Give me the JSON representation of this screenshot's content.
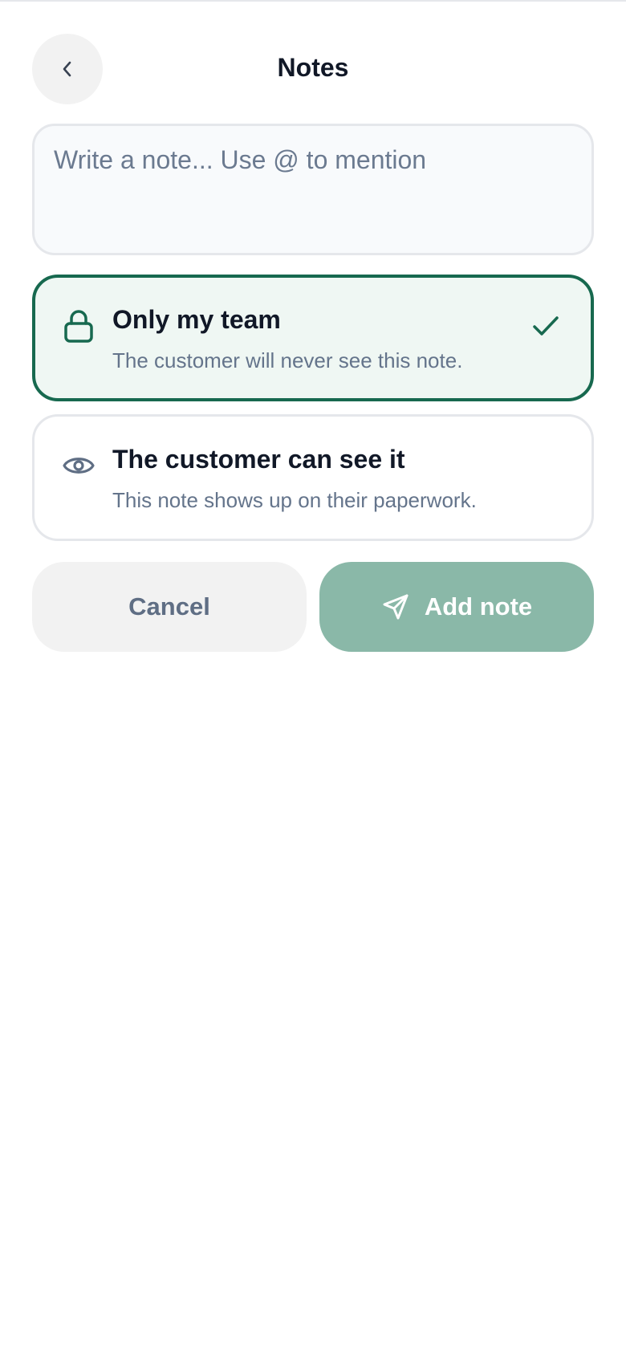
{
  "header": {
    "title": "Notes",
    "back_icon": "chevron-left-icon"
  },
  "note_input": {
    "value": "",
    "placeholder": "Write a note... Use @ to mention"
  },
  "visibility_options": [
    {
      "title": "Only my team",
      "description": "The customer will never see this note.",
      "icon": "lock-icon",
      "selected": true
    },
    {
      "title": "The customer can see it",
      "description": "This note shows up on their paperwork.",
      "icon": "eye-icon",
      "selected": false
    }
  ],
  "actions": {
    "cancel_label": "Cancel",
    "add_label": "Add note",
    "add_icon": "send-icon"
  },
  "colors": {
    "accent": "#17694f",
    "selected_bg": "#eff7f3",
    "add_button_bg": "#8ab8a8",
    "muted_text": "#64748b"
  }
}
